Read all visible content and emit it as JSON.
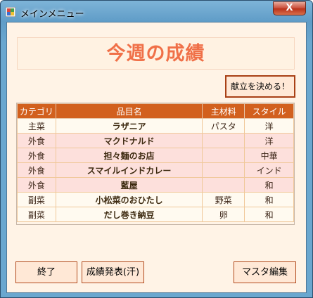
{
  "window": {
    "title": "メインメニュー",
    "close_label": "X"
  },
  "banner": {
    "title": "今週の成績"
  },
  "buttons": {
    "menu": "献立を決める！",
    "exit": "終了",
    "results": "成績発表(汗)",
    "master": "マスタ編集"
  },
  "table": {
    "headers": [
      "カテゴリ",
      "品目名",
      "主材料",
      "スタイル"
    ],
    "rows": [
      {
        "category": "主菜",
        "name": "ラザニア",
        "main": "パスタ",
        "style": "洋"
      },
      {
        "category": "外食",
        "name": "マクドナルド",
        "main": "",
        "style": "洋"
      },
      {
        "category": "外食",
        "name": "担々麺のお店",
        "main": "",
        "style": "中華"
      },
      {
        "category": "外食",
        "name": "スマイルインドカレー",
        "main": "",
        "style": "インド"
      },
      {
        "category": "外食",
        "name": "藍屋",
        "main": "",
        "style": "和"
      },
      {
        "category": "副菜",
        "name": "小松菜のおひたし",
        "main": "野菜",
        "style": "和"
      },
      {
        "category": "副菜",
        "name": "だし巻き納豆",
        "main": "卵",
        "style": "和"
      }
    ]
  },
  "colors": {
    "accent": "#d2601e",
    "title": "#f07048",
    "background": "#fff3e6"
  }
}
